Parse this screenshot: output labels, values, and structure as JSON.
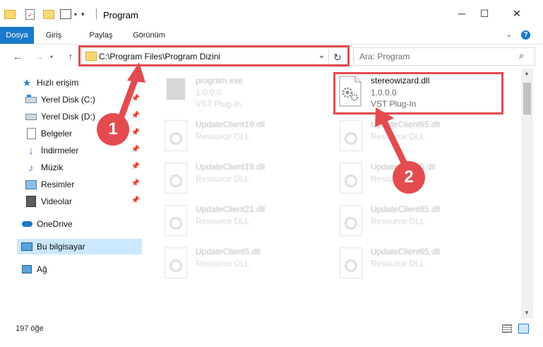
{
  "window": {
    "title": "Program",
    "minimize": "─",
    "maximize": "☐",
    "close": "✕"
  },
  "ribbon": {
    "tabs": [
      "Dosya",
      "Giriş",
      "Paylaş",
      "Görünüm"
    ]
  },
  "address": {
    "path": "C:\\Program Files\\Program Dizini"
  },
  "search": {
    "placeholder": "Ara: Program"
  },
  "sidebar": {
    "items": [
      {
        "label": "Hızlı erişim",
        "icon": "star-icon",
        "pinned": false
      },
      {
        "label": "Yerel Disk (C:)",
        "icon": "drive-c-icon",
        "pinned": true
      },
      {
        "label": "Yerel Disk (D:)",
        "icon": "drive-d-icon",
        "pinned": true
      },
      {
        "label": "Belgeler",
        "icon": "documents-icon",
        "pinned": true
      },
      {
        "label": "İndirmeler",
        "icon": "downloads-icon",
        "pinned": true
      },
      {
        "label": "Müzik",
        "icon": "music-icon",
        "pinned": true
      },
      {
        "label": "Resimler",
        "icon": "pictures-icon",
        "pinned": true
      },
      {
        "label": "Videolar",
        "icon": "videos-icon",
        "pinned": true
      },
      {
        "label": "OneDrive",
        "icon": "cloud-icon",
        "pinned": false
      },
      {
        "label": "Bu bilgisayar",
        "icon": "computer-icon",
        "pinned": false
      },
      {
        "label": "Ağ",
        "icon": "network-icon",
        "pinned": false
      }
    ]
  },
  "files": [
    {
      "name": "program.exe",
      "line2": "1.0.0.0",
      "line3": "VST Plug-In",
      "faded": true
    },
    {
      "name": "stereowizard.dll",
      "line2": "1.0.0.0",
      "line3": "VST Plug-In",
      "faded": false
    },
    {
      "name": "UpdateClient19.dll",
      "line2": "Resource DLL",
      "faded": true
    },
    {
      "name": "UpdateClient65.dll",
      "line2": "Resource DLL",
      "faded": true
    },
    {
      "name": "UpdateClient19.dll",
      "line2": "Resource DLL",
      "faded": true
    },
    {
      "name": "UpdateClient5.dll",
      "line2": "Resource DLL",
      "faded": true
    },
    {
      "name": "UpdateClient21.dll",
      "line2": "Resource DLL",
      "faded": true
    },
    {
      "name": "UpdateClient65.dll",
      "line2": "Resource DLL",
      "faded": true
    },
    {
      "name": "UpdateClient5.dll",
      "line2": "Resource DLL",
      "faded": true
    },
    {
      "name": "UpdateClient65.dll",
      "line2": "Resource DLL",
      "faded": true
    }
  ],
  "status": {
    "count": "197 öğe"
  },
  "callouts": {
    "one": "1",
    "two": "2"
  },
  "colors": {
    "accent": "#1979ca",
    "highlight": "#e34b4f",
    "selected": "#cce8ff",
    "folder": "#f8d775"
  }
}
